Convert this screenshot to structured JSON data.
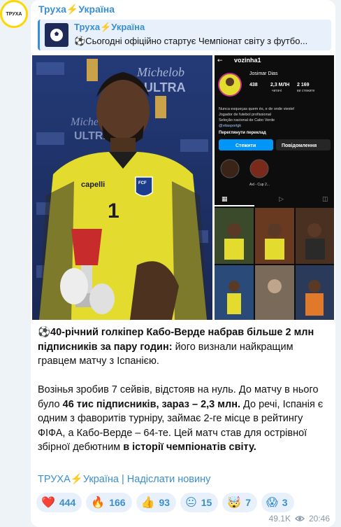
{
  "channel": {
    "name": "Труха⚡Україна",
    "avatar_text": "ТРУХА"
  },
  "forwarded": {
    "name": "Труха⚡Україна",
    "preview": "⚽Сьогодні офіційно стартує Чемпіонат світу з футбо..."
  },
  "media": {
    "left": {
      "sponsor_text": "Michelob ULTRA",
      "jersey_number": "1",
      "shirt_brand": "capelli",
      "crest_text": "FCF"
    },
    "instagram": {
      "username": "vozinha1",
      "name": "Josimar Dias",
      "stats": [
        "438",
        "2,3 МЛН",
        "2 169"
      ],
      "stats_labels": [
        "",
        "читачі",
        "ви стежите"
      ],
      "bio_lines": [
        "Nunca esqueças quem és, e de onde vieste!",
        "Jogador de futebol profissional ⚽",
        "Seleção nacional de Cabo Verde 🇨🇻",
        "@vitasportgk"
      ],
      "translate": "Переглянути переклад",
      "follow": "Стежити",
      "message": "Повідомлення",
      "highlights": [
        "",
        "Axl - Cup 2..."
      ]
    }
  },
  "caption": {
    "p1_bold": "⚽40-річний голкіпер Кабо-Верде набрав більше 2 млн підписників за пару годин:",
    "p1_rest": " його визнали найкращим гравцем матчу з Іспанією.",
    "p2_a": "Возінья зробив 7 сейвів, відстояв на нуль. До матчу в нього було ",
    "p2_b": "46 тис підписників, зараз – 2,3 млн.",
    "p2_c": " До речі, Іспанія є одним з фаворитів турніру, займає 2-ге місце в рейтингу ФІФА, а Кабо-Верде – 64-те. Цей матч став для острівної збірної дебютним ",
    "p2_d": "в історії чемпіонатів світу."
  },
  "footer": {
    "channel_link": "ТРУХА⚡Україна",
    "separator": "|",
    "submit_link": "Надіслати новину"
  },
  "reactions": [
    {
      "emoji": "❤️",
      "count": "444"
    },
    {
      "emoji": "🔥",
      "count": "166"
    },
    {
      "emoji": "👍",
      "count": "93"
    },
    {
      "emoji": "😐",
      "count": "15"
    },
    {
      "emoji": "🤯",
      "count": "7"
    },
    {
      "emoji": "😱",
      "count": "3"
    }
  ],
  "meta": {
    "views": "49.1K",
    "time": "20:46"
  },
  "colors": {
    "accent": "#3a8fcf",
    "bubble": "#ffffff",
    "background": "#eef3f8",
    "reaction_bg": "#e8f1fb"
  }
}
